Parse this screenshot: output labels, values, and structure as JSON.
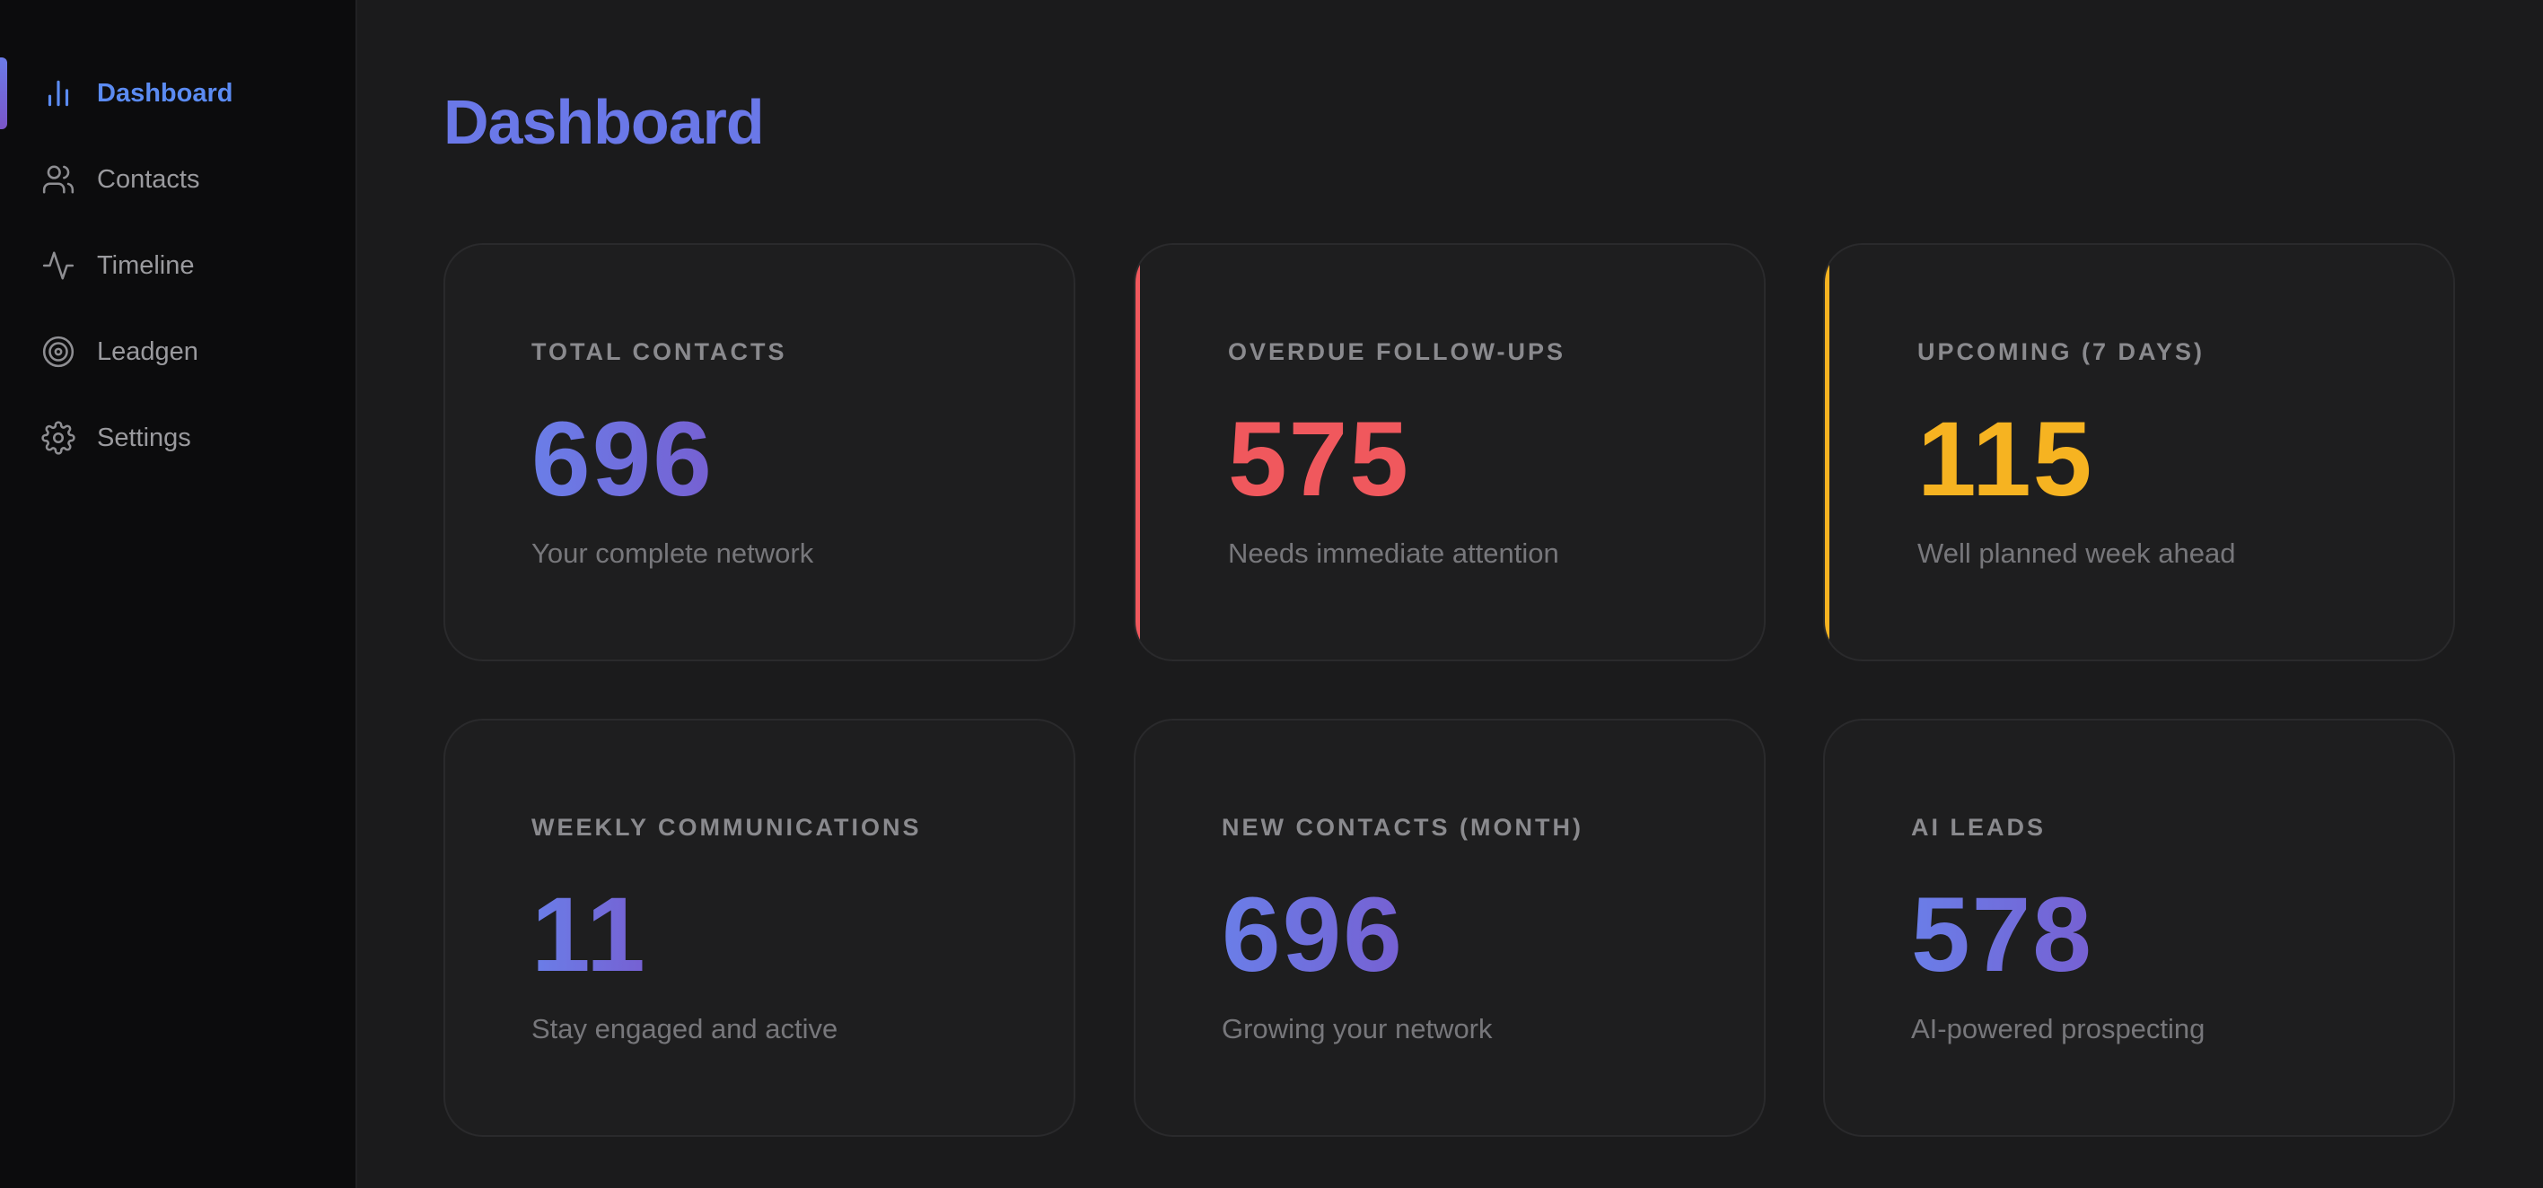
{
  "sidebar": {
    "items": [
      {
        "label": "Dashboard",
        "icon": "bar-chart-icon",
        "active": true
      },
      {
        "label": "Contacts",
        "icon": "users-icon",
        "active": false
      },
      {
        "label": "Timeline",
        "icon": "activity-icon",
        "active": false
      },
      {
        "label": "Leadgen",
        "icon": "target-icon",
        "active": false
      },
      {
        "label": "Settings",
        "icon": "gear-icon",
        "active": false
      }
    ]
  },
  "page": {
    "title": "Dashboard"
  },
  "colors": {
    "accent_blue": "#6a78e8",
    "active_nav": "#5b8bf2",
    "overdue_red": "#f0585d",
    "upcoming_amber": "#f6b321",
    "background": "#1b1b1c",
    "sidebar_background": "#0c0c0d"
  },
  "cards": [
    {
      "label": "TOTAL CONTACTS",
      "value": "696",
      "subtitle": "Your complete network"
    },
    {
      "label": "OVERDUE FOLLOW-UPS",
      "value": "575",
      "subtitle": "Needs immediate attention"
    },
    {
      "label": "UPCOMING (7 DAYS)",
      "value": "115",
      "subtitle": "Well planned week ahead"
    },
    {
      "label": "WEEKLY COMMUNICATIONS",
      "value": "11",
      "subtitle": "Stay engaged and active"
    },
    {
      "label": "NEW CONTACTS (MONTH)",
      "value": "696",
      "subtitle": "Growing your network"
    },
    {
      "label": "AI LEADS",
      "value": "578",
      "subtitle": "AI-powered prospecting"
    }
  ]
}
